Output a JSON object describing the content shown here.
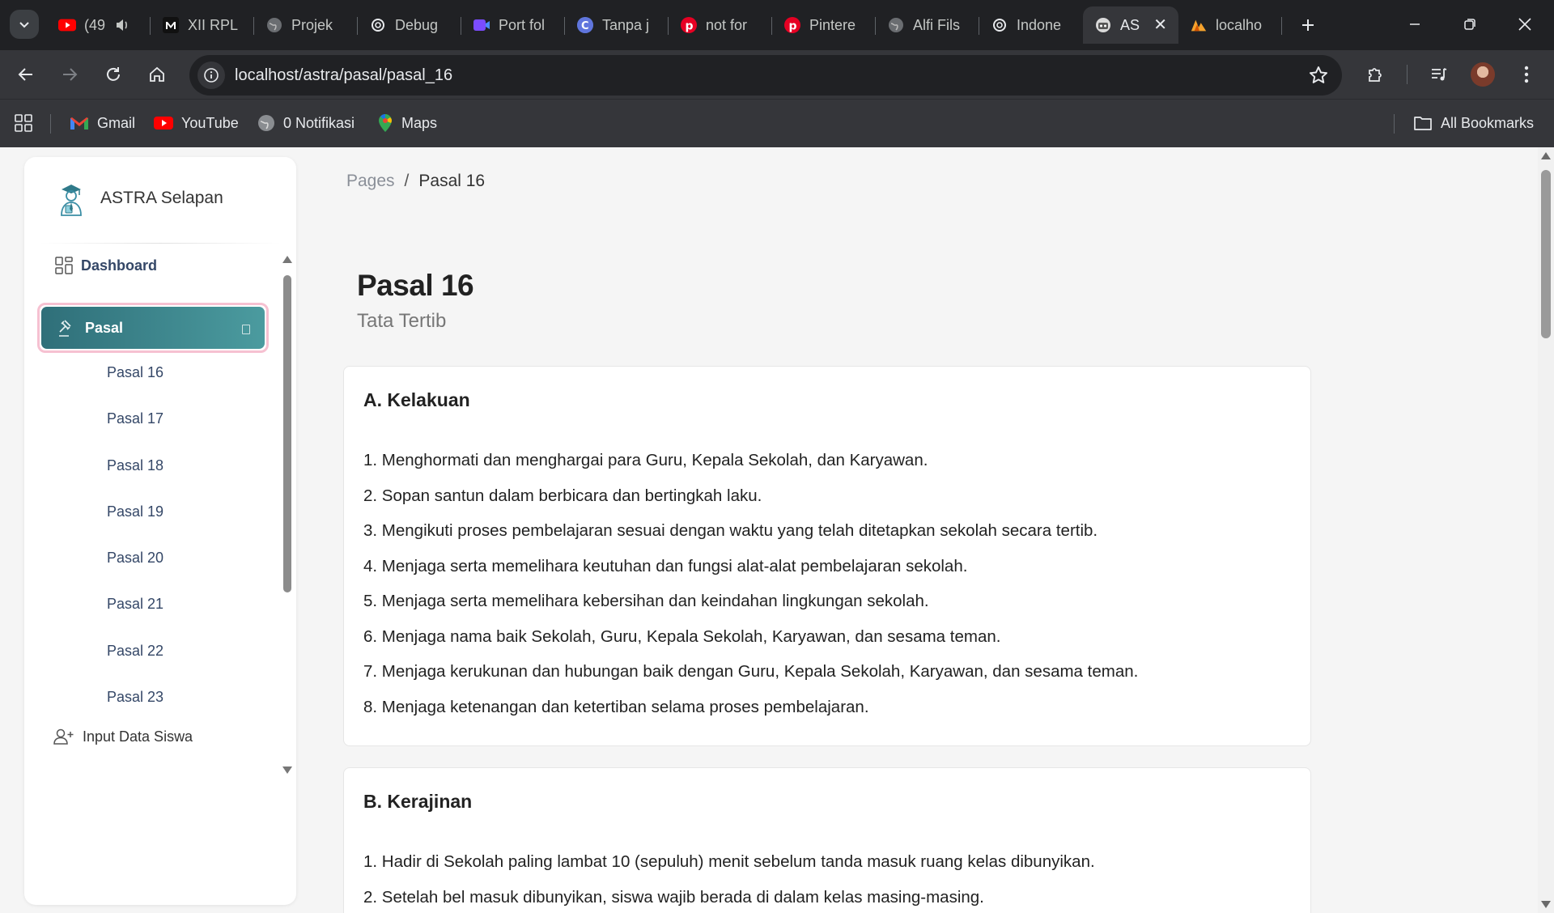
{
  "browser": {
    "tabs": [
      {
        "title": "(49",
        "icon": "youtube-icon",
        "extra": "speaker-icon"
      },
      {
        "title": "XII RPL",
        "icon": "m-logo-icon"
      },
      {
        "title": "Projek",
        "icon": "globe-icon"
      },
      {
        "title": "Debug",
        "icon": "openai-icon"
      },
      {
        "title": "Port fol",
        "icon": "video-icon"
      },
      {
        "title": "Tanpa j",
        "icon": "canva-icon"
      },
      {
        "title": "not for",
        "icon": "pinterest-icon"
      },
      {
        "title": "Pintere",
        "icon": "pinterest-icon"
      },
      {
        "title": "Alfi Fils",
        "icon": "globe-icon"
      },
      {
        "title": "Indone",
        "icon": "openai-icon"
      },
      {
        "title": "AS",
        "icon": "astra-icon",
        "active": true
      },
      {
        "title": "localho",
        "icon": "xampp-icon"
      }
    ],
    "url": "localhost/astra/pasal/pasal_16",
    "bookmarks": [
      {
        "label": "Gmail",
        "icon": "gmail-icon"
      },
      {
        "label": "YouTube",
        "icon": "youtube-icon"
      },
      {
        "label": "0 Notifikasi",
        "icon": "globe-icon"
      },
      {
        "label": "Maps",
        "icon": "maps-icon"
      }
    ],
    "all_bookmarks": "All Bookmarks"
  },
  "sidebar": {
    "brand": "ASTRA Selapan",
    "dashboard": "Dashboard",
    "pasal": "Pasal",
    "sub_items": [
      "Pasal 16",
      "Pasal 17",
      "Pasal 18",
      "Pasal 19",
      "Pasal 20",
      "Pasal 21",
      "Pasal 22",
      "Pasal 23"
    ],
    "input_data": "Input Data Siswa"
  },
  "breadcrumb": {
    "root": "Pages",
    "sep": "/",
    "current": "Pasal 16"
  },
  "page": {
    "title": "Pasal 16",
    "subtitle": "Tata Tertib",
    "sections": [
      {
        "heading": "A. Kelakuan",
        "items": [
          "1. Menghormati dan menghargai para Guru, Kepala Sekolah, dan Karyawan.",
          "2. Sopan santun dalam berbicara dan bertingkah laku.",
          "3. Mengikuti proses pembelajaran sesuai dengan waktu yang telah ditetapkan sekolah secara tertib.",
          "4. Menjaga serta memelihara keutuhan dan fungsi alat-alat pembelajaran sekolah.",
          "5. Menjaga serta memelihara kebersihan dan keindahan lingkungan sekolah.",
          "6. Menjaga nama baik Sekolah, Guru, Kepala Sekolah, Karyawan, dan sesama teman.",
          "7. Menjaga kerukunan dan hubungan baik dengan Guru, Kepala Sekolah, Karyawan, dan sesama teman.",
          "8. Menjaga ketenangan dan ketertiban selama proses pembelajaran."
        ]
      },
      {
        "heading": "B. Kerajinan",
        "items": [
          "1. Hadir di Sekolah paling lambat 10 (sepuluh) menit sebelum tanda masuk ruang kelas dibunyikan.",
          "2. Setelah bel masuk dibunyikan, siswa wajib berada di dalam kelas masing-masing."
        ]
      }
    ]
  },
  "colors": {
    "accent_start": "#2f6f79",
    "accent_end": "#4b9b9f",
    "active_ring": "#f6c1d1",
    "chrome_dark": "#202124",
    "chrome_mid": "#35363a"
  }
}
